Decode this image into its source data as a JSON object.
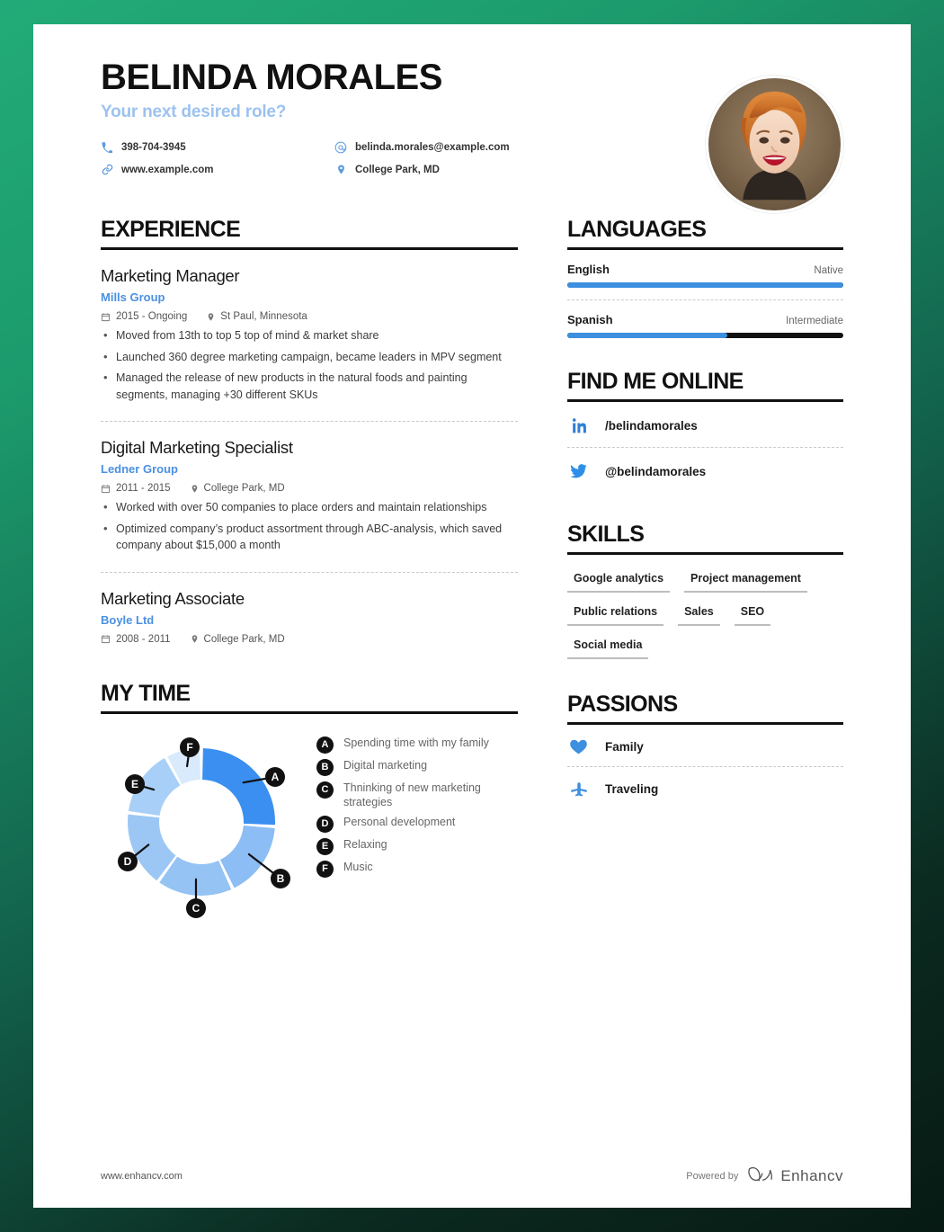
{
  "header": {
    "name": "BELINDA MORALES",
    "subtitle": "Your next desired role?",
    "contacts": [
      {
        "icon": "phone-icon",
        "value": "398-704-3945"
      },
      {
        "icon": "email-icon",
        "value": "belinda.morales@example.com"
      },
      {
        "icon": "link-icon",
        "value": "www.example.com"
      },
      {
        "icon": "location-pin-icon",
        "value": "College Park, MD"
      }
    ],
    "photo_alt": "portrait-photo"
  },
  "experience": {
    "title": "EXPERIENCE",
    "jobs": [
      {
        "role": "Marketing Manager",
        "company": "Mills Group",
        "dates": "2015 - Ongoing",
        "location": "St Paul, Minnesota",
        "bullets": [
          "Moved from 13th to top 5 top of mind & market share",
          "Launched 360 degree marketing campaign, became leaders in MPV segment",
          "Managed the release of new products in the natural foods and painting segments, managing +30 different SKUs"
        ]
      },
      {
        "role": "Digital Marketing Specialist",
        "company": "Ledner Group",
        "dates": "2011 - 2015",
        "location": "College Park, MD",
        "bullets": [
          "Worked with over 50 companies to place orders and maintain relationships",
          "Optimized company’s product assortment through ABC-analysis, which saved company about $15,000 a month"
        ]
      },
      {
        "role": "Marketing Associate",
        "company": "Boyle Ltd",
        "dates": "2008 - 2011",
        "location": "College Park, MD",
        "bullets": []
      }
    ]
  },
  "mytime": {
    "title": "MY TIME",
    "legend": [
      {
        "key": "A",
        "label": "Spending time with my family"
      },
      {
        "key": "B",
        "label": "Digital marketing"
      },
      {
        "key": "C",
        "label": "Thninking of new marketing strategies"
      },
      {
        "key": "D",
        "label": "Personal development"
      },
      {
        "key": "E",
        "label": "Relaxing"
      },
      {
        "key": "F",
        "label": "Music"
      }
    ]
  },
  "chart_data": {
    "type": "pie",
    "title": "MY TIME",
    "subtype": "donut",
    "categories": [
      "A",
      "B",
      "C",
      "D",
      "E",
      "F"
    ],
    "labels": [
      "Spending time with my family",
      "Digital marketing",
      "Thninking of new marketing strategies",
      "Personal development",
      "Relaxing",
      "Music"
    ],
    "values": [
      26,
      17,
      17,
      17,
      15,
      8
    ],
    "units": "percent",
    "colors": [
      "#3a8ff0",
      "#8cbdf4",
      "#94c3f4",
      "#9cc7f5",
      "#a8cff7",
      "#d9eafc"
    ],
    "start_angle_deg": 0,
    "legend_position": "right",
    "grid": false
  },
  "languages": {
    "title": "LANGUAGES",
    "items": [
      {
        "name": "English",
        "level": "Native",
        "percent": 100
      },
      {
        "name": "Spanish",
        "level": "Intermediate",
        "percent": 58
      }
    ]
  },
  "online": {
    "title": "FIND ME ONLINE",
    "items": [
      {
        "icon": "linkedin-icon",
        "handle": "/belindamorales"
      },
      {
        "icon": "twitter-icon",
        "handle": "@belindamorales"
      }
    ]
  },
  "skills": {
    "title": "SKILLS",
    "items": [
      "Google analytics",
      "Project management",
      "Public relations",
      "Sales",
      "SEO",
      "Social media"
    ]
  },
  "passions": {
    "title": "PASSIONS",
    "items": [
      {
        "icon": "heart-icon",
        "label": "Family"
      },
      {
        "icon": "airplane-icon",
        "label": "Traveling"
      }
    ]
  },
  "footer": {
    "url": "www.enhancv.com",
    "powered_by": "Powered by",
    "brand": "Enhancv"
  },
  "theme": {
    "accent_blue": "#4a90e2",
    "light_blue": "#9cc2f0",
    "page_bg": "#ffffff",
    "backdrop_green": "#22ab78"
  }
}
